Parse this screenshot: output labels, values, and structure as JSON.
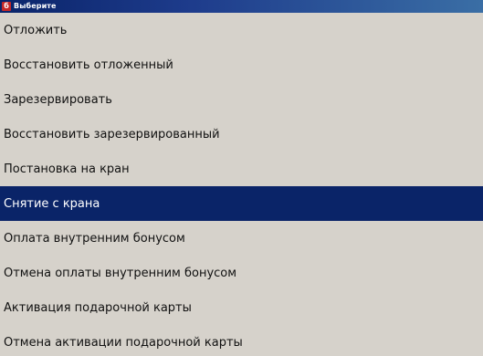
{
  "window": {
    "title": "Выберите",
    "icon_glyph": "б"
  },
  "colors": {
    "titlebar": "#0a246a",
    "background": "#d6d2cb",
    "selected_bg": "#0a2468",
    "selected_text": "#ffffff",
    "icon_bg": "#c62828"
  },
  "menu": {
    "selected_index": 5,
    "items": [
      {
        "label": "Отложить"
      },
      {
        "label": "Восстановить отложенный"
      },
      {
        "label": "Зарезервировать"
      },
      {
        "label": "Восстановить зарезервированный"
      },
      {
        "label": "Постановка на кран"
      },
      {
        "label": "Снятие с крана"
      },
      {
        "label": "Оплата внутренним бонусом"
      },
      {
        "label": "Отмена оплаты внутренним бонусом"
      },
      {
        "label": "Активация подарочной карты"
      },
      {
        "label": "Отмена активации подарочной карты"
      }
    ]
  }
}
